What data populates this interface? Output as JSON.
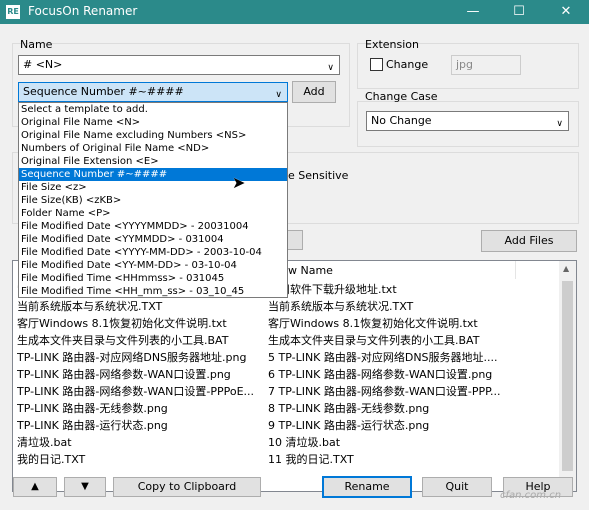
{
  "window": {
    "title": "FocusOn Renamer",
    "app_icon": "RE"
  },
  "name_group": {
    "legend": "Name",
    "value": "# <N>"
  },
  "template_select": {
    "selected": "Sequence Number #~####"
  },
  "add_label": "Add",
  "template_options": [
    "Select a template to add.",
    "Original File Name <N>",
    "Original File Name excluding Numbers <NS>",
    "Numbers of Original File Name <ND>",
    "Original File Extension <E>",
    "Sequence Number #~####",
    "File Size <z>",
    "File Size(KB) <zKB>",
    "Folder Name <P>",
    "File Modified Date <YYYYMMDD> - 20031004",
    "File Modified Date <YYMMDD> - 031004",
    "File Modified Date <YYYY-MM-DD> - 2003-10-04",
    "File Modified Date <YY-MM-DD> - 03-10-04",
    "File Modified Time <HHmmss> - 031045",
    "File Modified Time <HH_mm_ss> - 03_10_45"
  ],
  "extension_group": {
    "legend": "Extension",
    "checkbox_label": "Change",
    "value": "jpg"
  },
  "change_case_group": {
    "legend": "Change Case",
    "selected": "No Change"
  },
  "case_sensitive_fragment": "e Sensitive",
  "add_files_label": "Add Files",
  "list_header": {
    "new_name_fragment": "w Name"
  },
  "file_rows": [
    {
      "old": "常用软件下载升级地址.txt",
      "new": "常用软件下载升级地址.txt",
      "prefix": "!"
    },
    {
      "old": "当前系统版本与系统状况.TXT",
      "new": "当前系统版本与系统状况.TXT",
      "prefix": "2"
    },
    {
      "old": "客厅Windows 8.1恢复初始化文件说明.txt",
      "new": "客厅Windows 8.1恢复初始化文件说明.txt",
      "prefix": "3"
    },
    {
      "old": "生成本文件夹目录与文件列表的小工具.BAT",
      "new": "生成本文件夹目录与文件列表的小工具.BAT",
      "prefix": "4"
    },
    {
      "old": "TP-LINK 路由器-对应网络DNS服务器地址.png",
      "new": "5 TP-LINK 路由器-对应网络DNS服务器地址....",
      "prefix": ""
    },
    {
      "old": "TP-LINK 路由器-网络参数-WAN口设置.png",
      "new": "6 TP-LINK 路由器-网络参数-WAN口设置.png",
      "prefix": ""
    },
    {
      "old": "TP-LINK 路由器-网络参数-WAN口设置-PPPoE...",
      "new": "7 TP-LINK 路由器-网络参数-WAN口设置-PPP...",
      "prefix": ""
    },
    {
      "old": "TP-LINK 路由器-无线参数.png",
      "new": "8 TP-LINK 路由器-无线参数.png",
      "prefix": ""
    },
    {
      "old": "TP-LINK 路由器-运行状态.png",
      "new": "9 TP-LINK 路由器-运行状态.png",
      "prefix": ""
    },
    {
      "old": "清垃圾.bat",
      "new": "10 清垃圾.bat",
      "prefix": ""
    },
    {
      "old": "我的日记.TXT",
      "new": "11 我的日记.TXT",
      "prefix": ""
    }
  ],
  "bottom": {
    "up_label": "▲",
    "down_label": "▼",
    "copy_label": "Copy to Clipboard",
    "rename_label": "Rename",
    "quit_label": "Quit",
    "help_label": "Help"
  },
  "watermark": "cfan.com.cn",
  "colors": {
    "title_bar": "#2b8a8a",
    "selection": "#0078d7",
    "rename_border": "#0078d7"
  }
}
